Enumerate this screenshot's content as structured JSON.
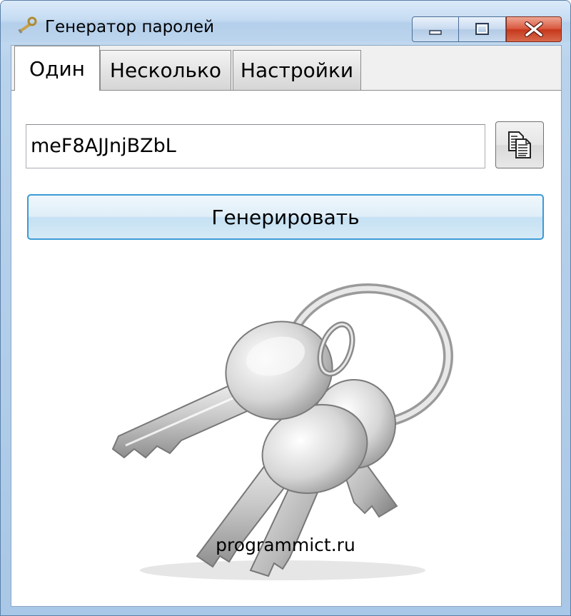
{
  "window": {
    "title": "Генератор паролей",
    "accent_color": "#3c9ad6"
  },
  "tabs": [
    {
      "label": "Один",
      "active": true
    },
    {
      "label": "Несколько",
      "active": false
    },
    {
      "label": "Настройки",
      "active": false
    }
  ],
  "password": {
    "value": "meF8AJJnjBZbL"
  },
  "copy_button": {
    "icon": "copy-icon"
  },
  "generate_button": {
    "label": "Генерировать"
  },
  "footer": {
    "website": "programmict.ru"
  },
  "image": {
    "icon": "keys-icon"
  }
}
